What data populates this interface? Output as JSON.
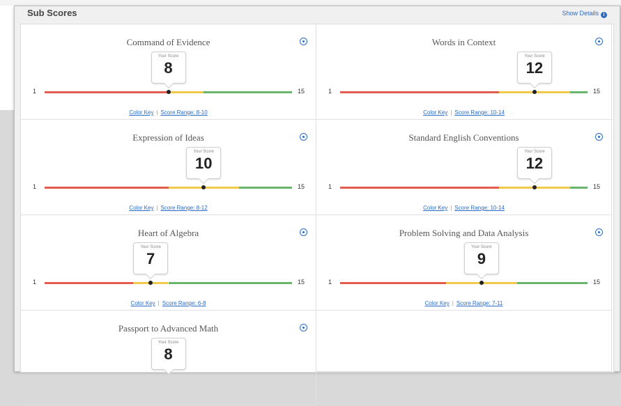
{
  "panel": {
    "title": "Sub Scores",
    "show_details": "Show Details"
  },
  "subscores": [
    {
      "title": "Command of Evidence",
      "your_score_label": "Your Score",
      "score": 8,
      "min": 1,
      "max": 15,
      "range_low": 8,
      "range_high": 10,
      "color_key": "Color Key",
      "score_range": "Score Range: 8-10"
    },
    {
      "title": "Words in Context",
      "your_score_label": "Your Score",
      "score": 12,
      "min": 1,
      "max": 15,
      "range_low": 10,
      "range_high": 14,
      "color_key": "Color Key",
      "score_range": "Score Range: 10-14"
    },
    {
      "title": "Expression of Ideas",
      "your_score_label": "Your Score",
      "score": 10,
      "min": 1,
      "max": 15,
      "range_low": 8,
      "range_high": 12,
      "color_key": "Color Key",
      "score_range": "Score Range: 8-12"
    },
    {
      "title": "Standard English Conventions",
      "your_score_label": "Your Score",
      "score": 12,
      "min": 1,
      "max": 15,
      "range_low": 10,
      "range_high": 14,
      "color_key": "Color Key",
      "score_range": "Score Range: 10-14"
    },
    {
      "title": "Heart of Algebra",
      "your_score_label": "Your Score",
      "score": 7,
      "min": 1,
      "max": 15,
      "range_low": 6,
      "range_high": 8,
      "color_key": "Color Key",
      "score_range": "Score Range: 6-8"
    },
    {
      "title": "Problem Solving and Data Analysis",
      "your_score_label": "Your Score",
      "score": 9,
      "min": 1,
      "max": 15,
      "range_low": 7,
      "range_high": 11,
      "color_key": "Color Key",
      "score_range": "Score Range: 7-11"
    },
    {
      "title": "Passport to Advanced Math",
      "your_score_label": "Your Score",
      "score": 8,
      "min": 1,
      "max": 15
    }
  ],
  "colors": {
    "red": "#e25c4f",
    "yellow": "#f0c84a",
    "green": "#6ab56e",
    "link": "#2a6bc8"
  }
}
